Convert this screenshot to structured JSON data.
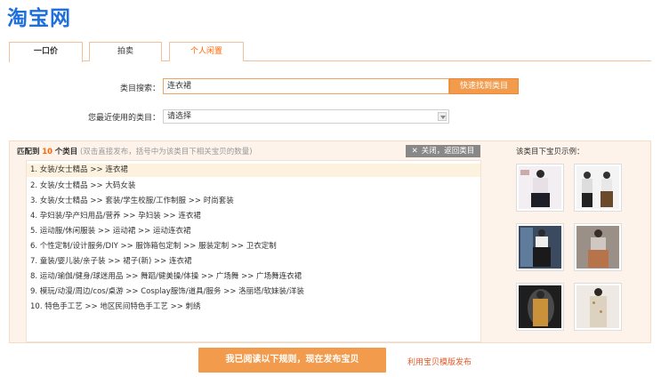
{
  "brand": {
    "logo_text": "淘宝网"
  },
  "tabs": [
    {
      "label": "一口价",
      "active": true
    },
    {
      "label": "拍卖",
      "active": false
    },
    {
      "label": "个人闲置",
      "active": false
    }
  ],
  "category_search": {
    "label": "类目搜索：",
    "value": "连衣裙",
    "button_label": "快速找到类目"
  },
  "recent_category": {
    "label": "您最近使用的类目：",
    "selected": "请选择"
  },
  "results": {
    "prefix": "匹配到",
    "count": "10",
    "suffix": "个类目",
    "hint": "(双击直接发布，括号中为该类目下相关宝贝的数量)",
    "close_label": "关闭，返回类目",
    "items": [
      "1. 女装/女士精品 >> 连衣裙",
      "2. 女装/女士精品 >> 大码女装",
      "3. 女装/女士精品 >> 套装/学生校服/工作制服 >> 时尚套装",
      "4. 孕妇装/孕产妇用品/营养 >> 孕妇装 >> 连衣裙",
      "5. 运动服/休闲服装 >> 运动裙 >> 运动连衣裙",
      "6. 个性定制/设计服务/DIY >> 服饰箱包定制 >> 服装定制 >> 卫衣定制",
      "7. 童装/婴儿装/亲子装 >> 裙子(新) >> 连衣裙",
      "8. 运动/瑜伽/健身/球迷用品 >> 舞蹈/健美操/体操 >> 广场舞 >> 广场舞连衣裙",
      "9. 模玩/动漫/周边/cos/桌游 >> Cosplay服饰/道具/服务 >> 洛丽塔/软妹装/洋装",
      "10. 特色手工艺 >> 地区民间特色手工艺 >> 刺绣"
    ]
  },
  "examples": {
    "title": "该类目下宝贝示例："
  },
  "footer": {
    "publish_label": "我已阅读以下规则，现在发布宝贝",
    "template_link": "利用宝贝模版发布"
  },
  "colors": {
    "brand_blue": "#1e6fd9",
    "accent_orange": "#f29b4d",
    "link_red": "#e05a2a",
    "highlight_row": "#fdf2de"
  }
}
